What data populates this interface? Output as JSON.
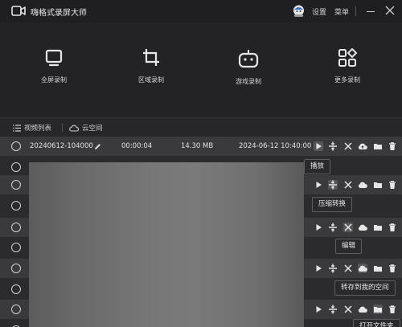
{
  "titlebar": {
    "app_name": "嗨格式录屏大师",
    "settings": "设置",
    "menu": "菜单"
  },
  "modes": [
    {
      "label": "全屏录制",
      "icon": "monitor-icon"
    },
    {
      "label": "区域录制",
      "icon": "crop-icon"
    },
    {
      "label": "游戏录制",
      "icon": "gamepad-icon"
    },
    {
      "label": "更多录制",
      "icon": "apps-icon"
    }
  ],
  "tabs": {
    "video_list": "视频列表",
    "cloud_space": "云空间"
  },
  "file": {
    "name": "20240612-104000",
    "duration": "00:00:04",
    "size": "14.30 MB",
    "created": "2024-06-12 10:40:00"
  },
  "tooltips": {
    "play": "播放",
    "compress": "压缩转换",
    "edit": "编辑",
    "save_cloud": "转存到我的空间",
    "open_folder": "打开文件夹"
  },
  "colors": {
    "background": "#2b2b2e",
    "titlebar": "#1f1f21",
    "text": "#d9d9d9"
  }
}
